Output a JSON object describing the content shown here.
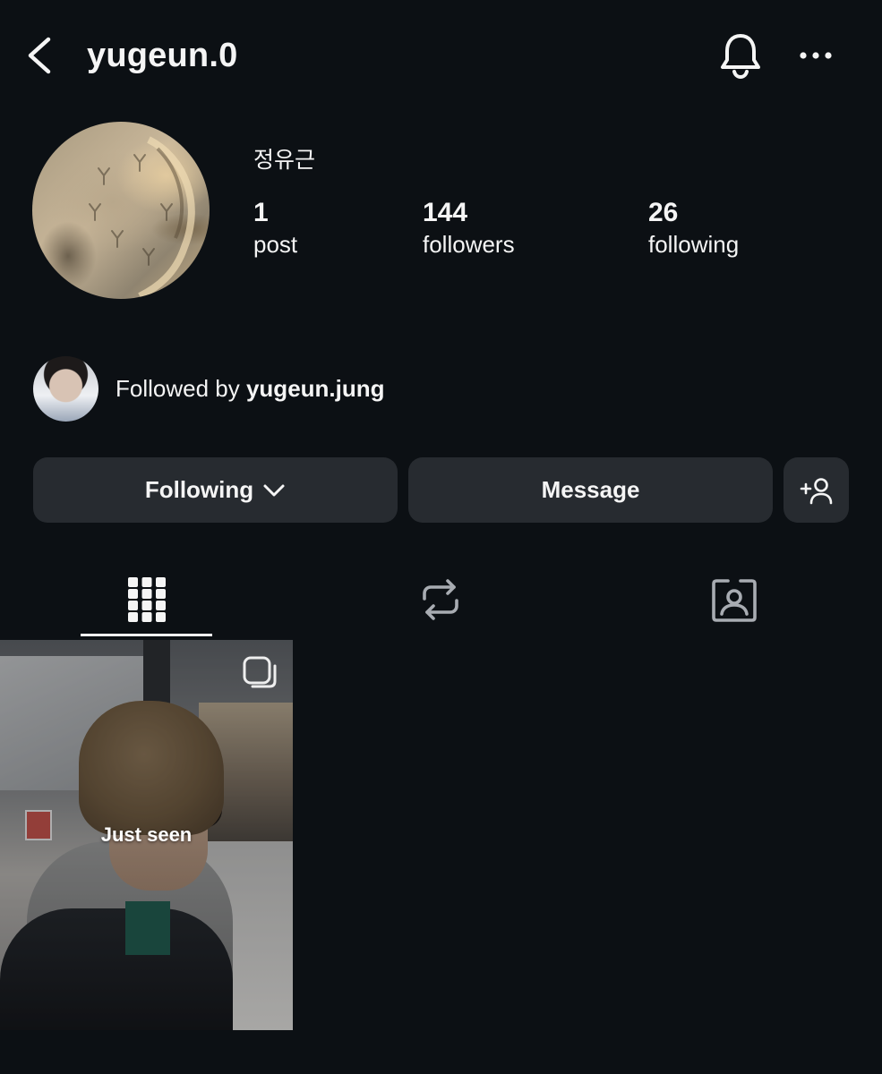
{
  "header": {
    "username": "yugeun.0",
    "icons": [
      "back-chevron",
      "bell",
      "more-horizontal"
    ]
  },
  "profile": {
    "full_name": "정유근",
    "stats": {
      "posts_count": "1",
      "posts_label": "post",
      "followers_count": "144",
      "followers_label": "followers",
      "following_count": "26",
      "following_label": "following"
    },
    "followed_by": {
      "prefix": "Followed by ",
      "user": "yugeun.jung"
    }
  },
  "actions": {
    "following_label": "Following",
    "message_label": "Message",
    "add_icon": "add-person"
  },
  "tabs": [
    {
      "name": "posts-grid",
      "icon": "grid",
      "active": true
    },
    {
      "name": "reposts",
      "icon": "repost",
      "active": false
    },
    {
      "name": "tagged",
      "icon": "tagged-person",
      "active": false
    }
  ],
  "posts": [
    {
      "overlay_text": "Just seen",
      "type": "multi"
    }
  ],
  "colors": {
    "background": "#0c1014",
    "button": "#272b30",
    "text": "#f5f5f5"
  }
}
